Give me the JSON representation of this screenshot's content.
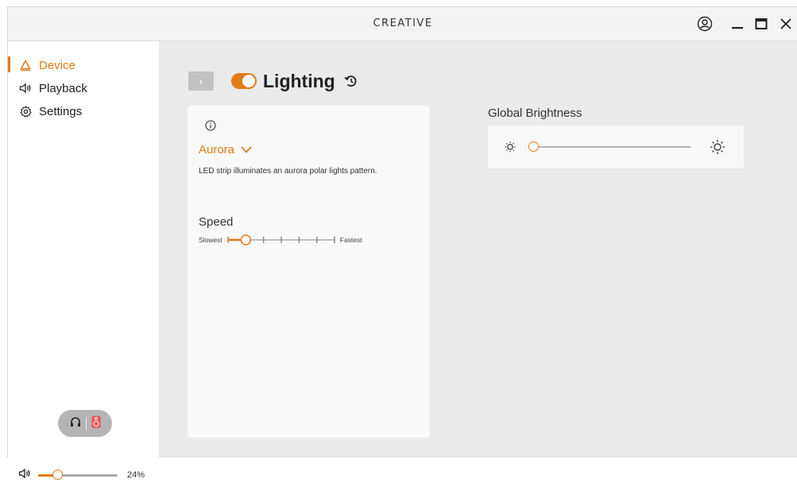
{
  "app": {
    "brand": "CREATIVE",
    "accent_color": "#e07b16",
    "window_controls": [
      "account-icon",
      "minimize-icon",
      "maximize-icon",
      "close-icon"
    ]
  },
  "sidebar": {
    "items": [
      {
        "label": "Device",
        "icon": "warning-triangle-icon",
        "active": true
      },
      {
        "label": "Playback",
        "icon": "speaker-icon",
        "active": false
      },
      {
        "label": "Settings",
        "icon": "gear-icon",
        "active": false
      }
    ],
    "output_toggle": {
      "options": [
        "headphones-icon",
        "speaker-box-icon"
      ],
      "selected": "speaker-box-icon"
    },
    "volume": {
      "icon": "speaker-icon",
      "value": 0.24,
      "label": "24%"
    }
  },
  "header": {
    "back_label": "‹",
    "toggle_on": true,
    "title": "Lighting",
    "reset_icon": "reset-icon"
  },
  "effect_panel": {
    "info_icon": "info-icon",
    "effect": "Aurora",
    "description": "LED strip illuminates an aurora polar lights pattern.",
    "speed": {
      "label": "Speed",
      "min_label": "Slowest",
      "max_label": "Fastest",
      "steps": 7,
      "value": 1
    }
  },
  "brightness": {
    "title": "Global Brightness",
    "value": 0
  }
}
